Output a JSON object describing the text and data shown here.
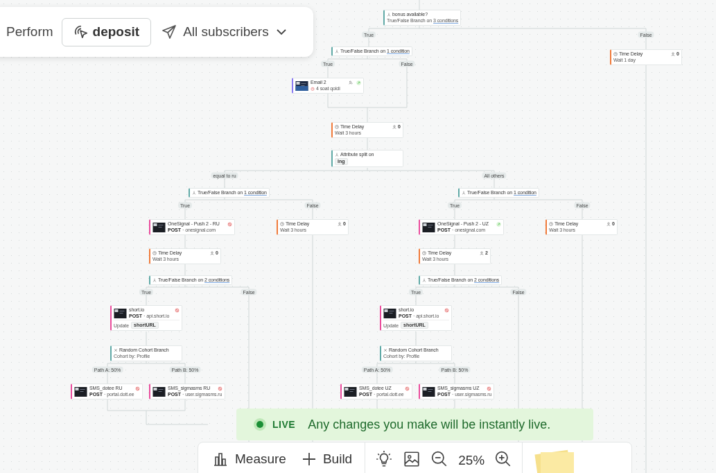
{
  "top_panel": {
    "label": "Perform",
    "trigger": "deposit",
    "audience": "All subscribers"
  },
  "nodes": [
    {
      "kind": "branch",
      "title": "bonus available?",
      "text": "True/False Branch on",
      "link": "3 conditions"
    },
    {
      "kind": "branch",
      "text": "True/False Branch on",
      "link": "1 condition"
    },
    {
      "kind": "delay",
      "title": "Time Delay",
      "subtitle": "Wait 1 day",
      "count": "0"
    },
    {
      "kind": "email",
      "title": "Email 2",
      "subtitle": "4 soat qoldi",
      "error": false
    },
    {
      "kind": "delay",
      "title": "Time Delay",
      "subtitle": "Wait 3 hours",
      "count": "0"
    },
    {
      "kind": "split",
      "title": "Attribute split on",
      "chip": "lng"
    },
    {
      "kind": "branch",
      "text": "True/False Branch on",
      "link": "1 condition"
    },
    {
      "kind": "branch",
      "text": "True/False Branch on",
      "link": "1 condition"
    },
    {
      "kind": "webhook",
      "title": "OneSignal - Push 2 - RU",
      "method": "POST",
      "host": "· onesignal.com",
      "error": true
    },
    {
      "kind": "delay",
      "title": "Time Delay",
      "subtitle": "Wait 3 hours",
      "count": "0"
    },
    {
      "kind": "webhook",
      "title": "OneSignal - Push 2 - UZ",
      "method": "POST",
      "host": "· onesignal.com",
      "error": false
    },
    {
      "kind": "delay",
      "title": "Time Delay",
      "subtitle": "Wait 3 hours",
      "count": "0"
    },
    {
      "kind": "delay",
      "title": "Time Delay",
      "subtitle": "Wait 3 hours",
      "count": "0"
    },
    {
      "kind": "delay",
      "title": "Time Delay",
      "subtitle": "Wait 3 hours",
      "count": "2"
    },
    {
      "kind": "branch",
      "text": "True/False Branch on",
      "link": "2 conditions"
    },
    {
      "kind": "branch",
      "text": "True/False Branch on",
      "link": "2 conditions"
    },
    {
      "kind": "webhook",
      "title": "short.io",
      "method": "POST",
      "host": "· api.short.io",
      "error": true,
      "update": "Update",
      "chip": "shortURL"
    },
    {
      "kind": "webhook",
      "title": "short.io",
      "method": "POST",
      "host": "· api.short.io",
      "error": true,
      "update": "Update",
      "chip": "shortURL"
    },
    {
      "kind": "cohort",
      "title": "Random Cohort Branch",
      "subtitle": "Cohort by: Profile"
    },
    {
      "kind": "cohort",
      "title": "Random Cohort Branch",
      "subtitle": "Cohort by: Profile"
    },
    {
      "kind": "webhook",
      "title": "SMS_dotee RU",
      "method": "POST",
      "host": "· portal.dott.ee",
      "error": true
    },
    {
      "kind": "webhook",
      "title": "SMS_sigmasms RU",
      "method": "POST",
      "host": "· user.sigmasms.ru",
      "error": true
    },
    {
      "kind": "webhook",
      "title": "SMS_dotee UZ",
      "method": "POST",
      "host": "· portal.dott.ee",
      "error": true
    },
    {
      "kind": "webhook",
      "title": "SMS_sigmasms UZ",
      "method": "POST",
      "host": "· user.sigmasms.ru",
      "error": true
    }
  ],
  "edge_labels": [
    "True",
    "False",
    "True",
    "False",
    "equal to ru",
    "All others",
    "True",
    "False",
    "True",
    "False",
    "True",
    "False",
    "True",
    "False",
    "Path A: 50%",
    "Path B: 50%",
    "Path A: 50%",
    "Path B: 50%"
  ],
  "live_banner": {
    "badge": "LIVE",
    "message": "Any changes you make will be instantly live."
  },
  "toolbar": {
    "measure": "Measure",
    "build": "Build",
    "zoom": "25%"
  }
}
